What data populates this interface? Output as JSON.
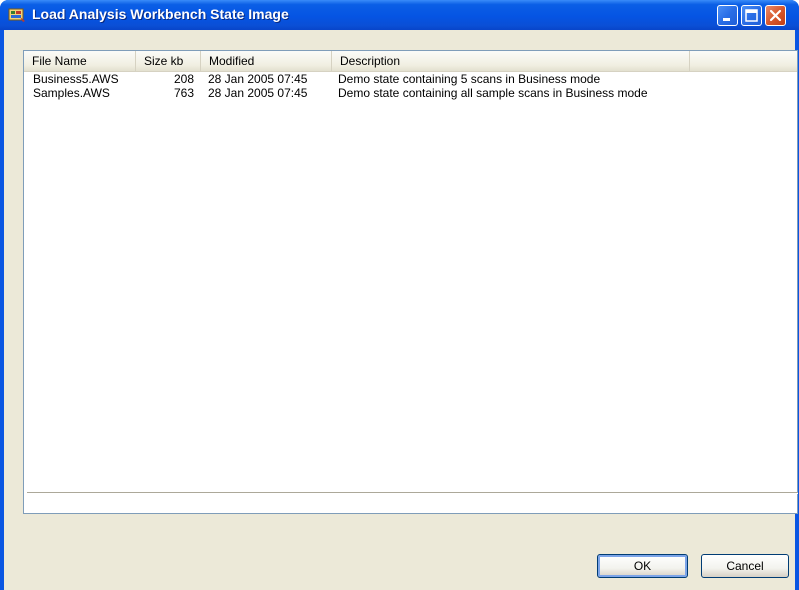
{
  "window": {
    "title": "Load Analysis Workbench State Image",
    "icon": "workbench-app-icon"
  },
  "titlebar_buttons": [
    "minimize-icon",
    "maximize-icon",
    "close-icon"
  ],
  "list": {
    "columns": [
      "File Name",
      "Size kb",
      "Modified",
      "Description"
    ],
    "rows": [
      {
        "name": "Business5.AWS",
        "size": "208",
        "modified": "28 Jan 2005 07:45",
        "description": "Demo state containing 5 scans in Business mode"
      },
      {
        "name": "Samples.AWS",
        "size": "763",
        "modified": "28 Jan 2005 07:45",
        "description": "Demo state containing all sample scans in Business mode"
      }
    ]
  },
  "buttons": {
    "ok_label": "OK",
    "cancel_label": "Cancel"
  },
  "colors": {
    "titlebar": "#0554e3",
    "close": "#d8582c",
    "dialog_face": "#ece9d8"
  }
}
